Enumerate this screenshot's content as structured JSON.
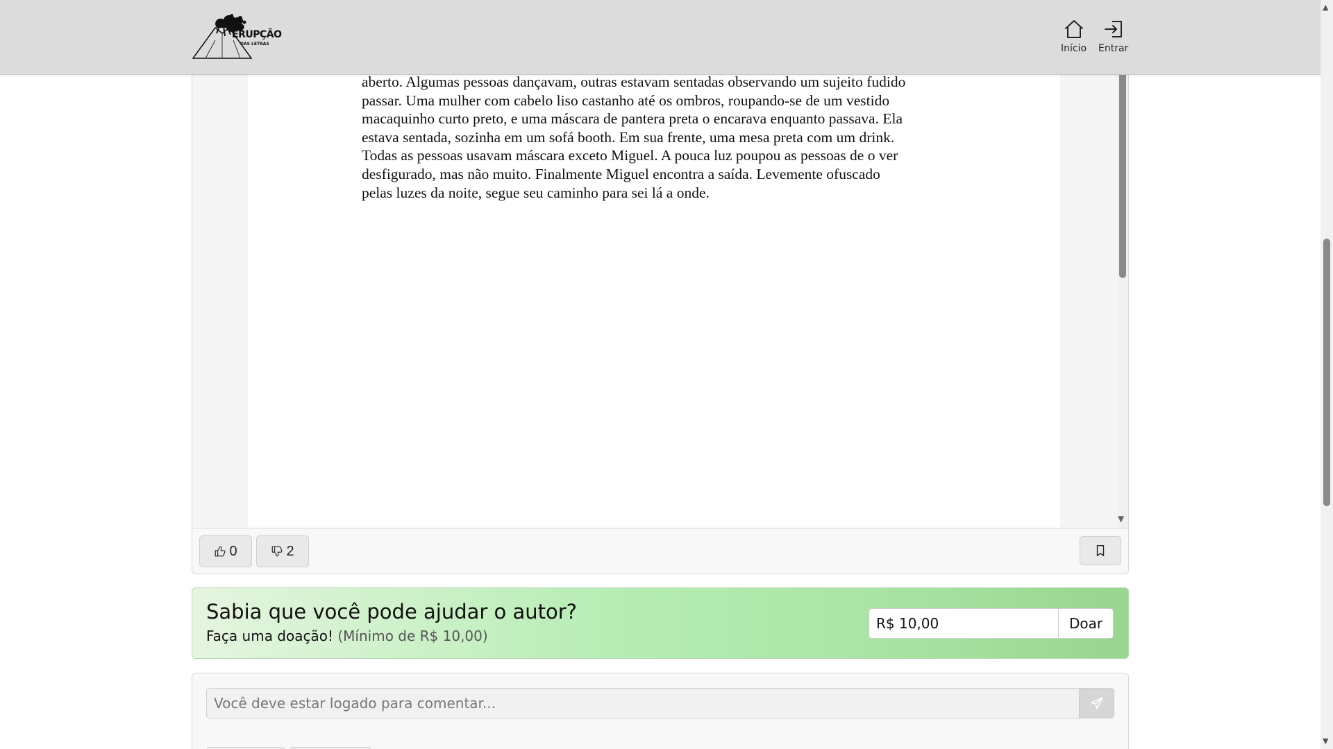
{
  "header": {
    "logo_title": "ERUPÇÃO",
    "logo_subtitle": "DAS LETRAS",
    "nav": [
      {
        "label": "Início",
        "icon": "house-icon"
      },
      {
        "label": "Entrar",
        "icon": "sign-in-icon"
      }
    ]
  },
  "document": {
    "lines": [
      "aberto. Algumas pessoas dançavam, outras estavam sentadas observando um sujeito fudido",
      "passar. Uma mulher com cabelo liso castanho até os ombros, roupando-se de um vestido",
      "macaquinho curto preto, e uma máscara de pantera preta o encarava enquanto passava. Ela",
      "estava sentada, sozinha em um sofá booth. Em sua frente, uma mesa preta com um drink.",
      "Todas as pessoas usavam máscara exceto Miguel. A pouca luz poupou as pessoas de o ver",
      "desfigurado, mas não muito. Finalmente Miguel encontra a saída. Levemente ofuscado",
      "pelas luzes da noite, segue seu caminho para sei lá a onde."
    ]
  },
  "reactions": {
    "likes": "0",
    "dislikes": "2"
  },
  "donation": {
    "title": "Sabia que você pode ajudar o autor?",
    "subtitle": "Faça uma doação!",
    "minimum": "(Mínimo de R$ 10,00)",
    "amount": "R$ 10,00",
    "button": "Doar"
  },
  "comments": {
    "placeholder": "Você deve estar logado para comentar..."
  },
  "colors": {
    "navbar_bg": "#dcdcdc",
    "donation_gradient_start": "#e5f5e0",
    "donation_gradient_end": "#99d58f"
  }
}
